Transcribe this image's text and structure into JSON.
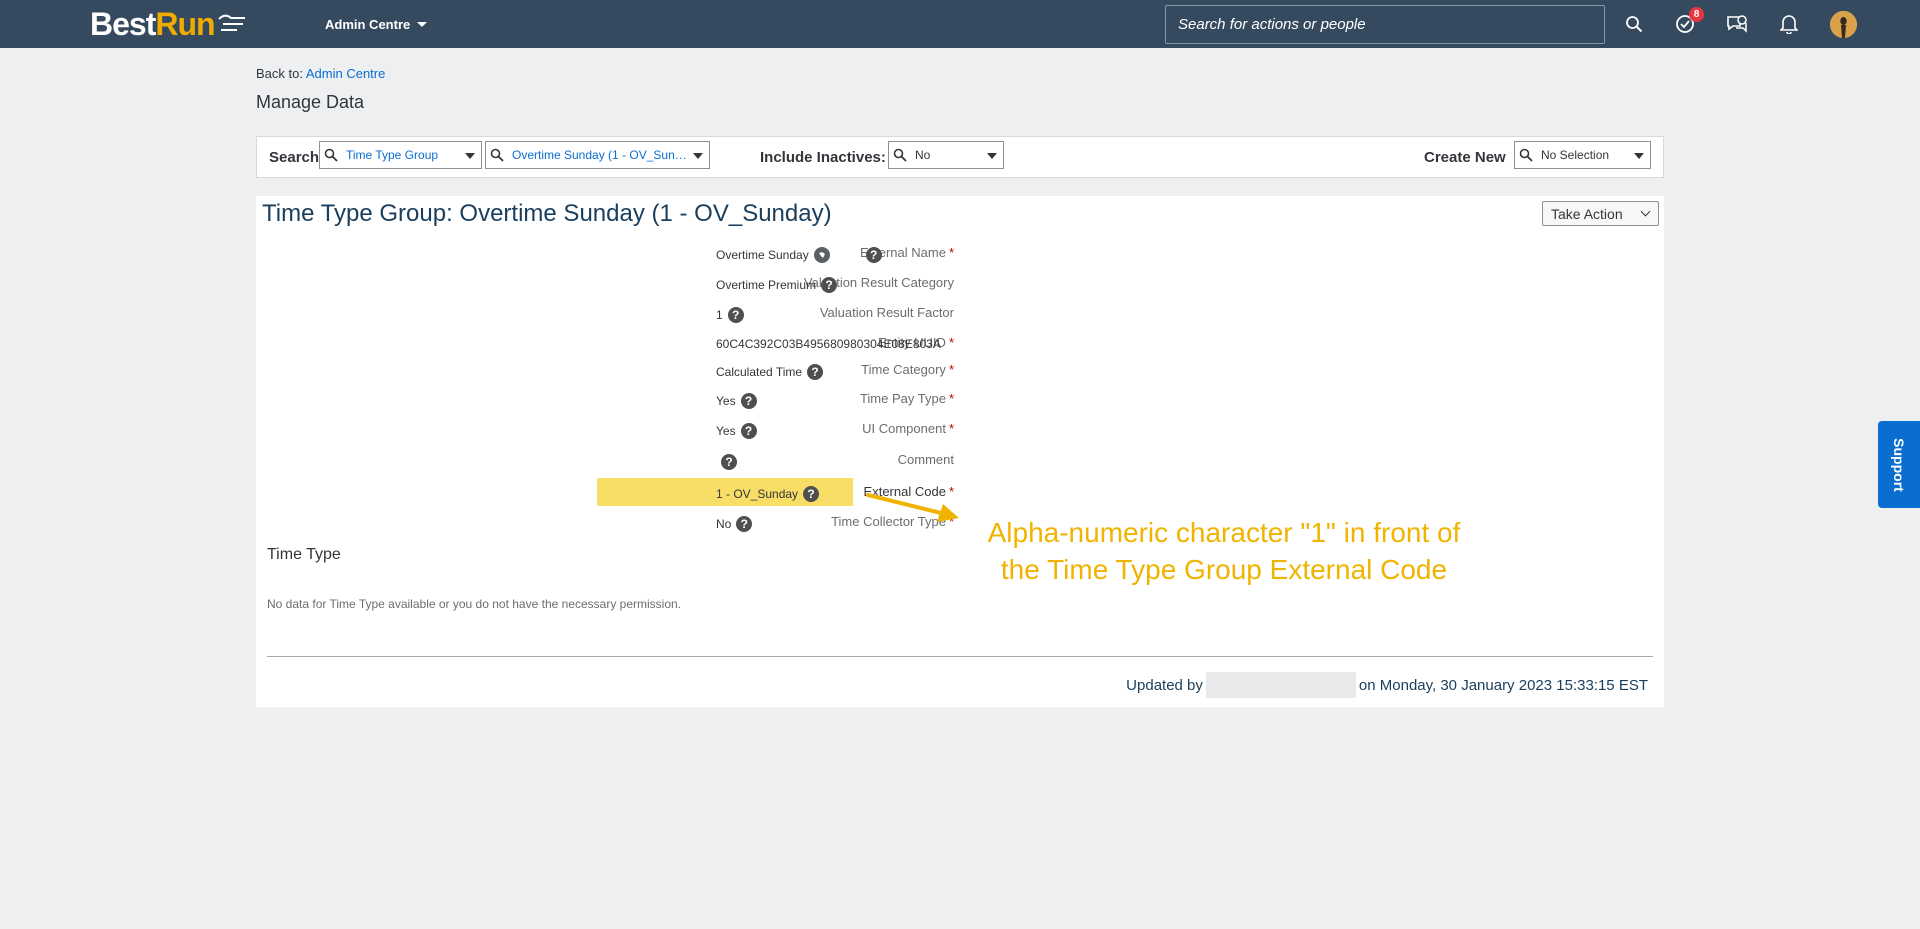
{
  "shellbar": {
    "logo_best": "Best",
    "logo_run": "Run",
    "app_menu": "Admin Centre",
    "search_placeholder": "Search for actions or people",
    "todo_badge": "8"
  },
  "breadcrumb": {
    "prefix": "Back to:",
    "link": "Admin Centre"
  },
  "page_title": "Manage Data",
  "searchbar": {
    "search_label": "Search",
    "object_type": "Time Type Group",
    "object_instance": "Overtime Sunday (1 - OV_Sunday...",
    "include_inactives_label": "Include Inactives:",
    "include_inactives_value": "No",
    "create_new_label": "Create New",
    "create_new_value": "No Selection"
  },
  "record": {
    "title": "Time Type Group: Overtime Sunday (1 - OV_Sunday)",
    "take_action": "Take Action",
    "fields": [
      {
        "label": "External Name",
        "value": "Overtime Sunday"
      },
      {
        "label": "Valuation Result Category",
        "value": "Overtime Premium"
      },
      {
        "label": "Valuation Result Factor",
        "value": "1"
      },
      {
        "label": "Entity UUID",
        "value": "60C4C392C03B495680980304E08E803A"
      },
      {
        "label": "Time Category",
        "value": "Calculated Time"
      },
      {
        "label": "Time Pay Type",
        "value": "Yes"
      },
      {
        "label": "UI Component",
        "value": "Yes"
      },
      {
        "label": "Comment",
        "value": ""
      },
      {
        "label": "External Code",
        "value": "1 - OV_Sunday"
      },
      {
        "label": "Time Collector Type",
        "value": "No"
      }
    ],
    "help_glyph": "?",
    "section_time_type": "Time Type",
    "no_data": "No data for Time Type available or you do not have the necessary permission.",
    "updated_prefix": "Updated by",
    "updated_date": "on Monday, 30 January 2023 15:33:15 EST"
  },
  "annotation": {
    "line1": "Alpha-numeric character \"1\" in front of",
    "line2": "the Time Type Group External Code",
    "color": "#f0b400"
  },
  "support_tab": "Support"
}
